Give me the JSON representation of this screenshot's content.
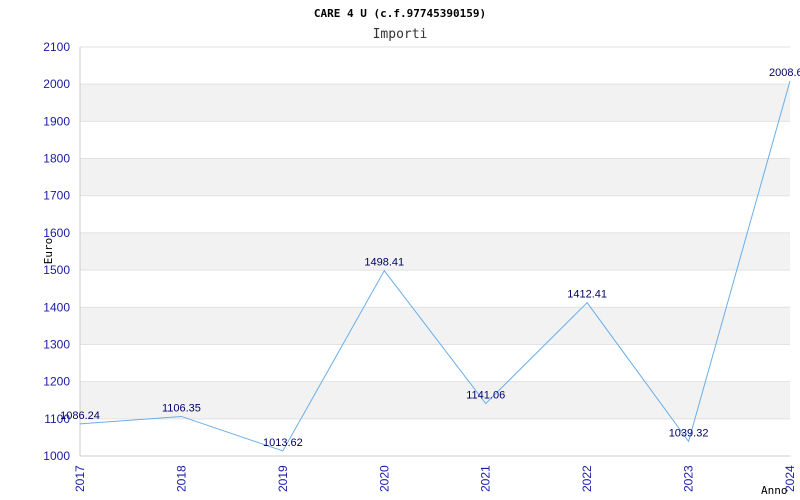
{
  "chart_data": {
    "type": "line",
    "title": "CARE 4 U (c.f.97745390159)",
    "subtitle": "Importi",
    "xlabel": "Anno",
    "ylabel": "Euro",
    "x": [
      "2017",
      "2018",
      "2019",
      "2020",
      "2021",
      "2022",
      "2023",
      "2024"
    ],
    "series": [
      {
        "values": [
          1086.24,
          1106.35,
          1013.62,
          1498.41,
          1141.06,
          1412.41,
          1039.32,
          2008.6
        ],
        "labels": [
          "1086.24",
          "1106.35",
          "1013.62",
          "1498.41",
          "1141.06",
          "1412.41",
          "1039.32",
          "2008.6"
        ],
        "color": "#6aaee8"
      }
    ],
    "ylim": [
      1000,
      2100
    ],
    "yticks": [
      "1000",
      "1100",
      "1200",
      "1300",
      "1400",
      "1500",
      "1600",
      "1700",
      "1800",
      "1900",
      "2000",
      "2100"
    ],
    "grid": true,
    "band_colors": [
      "#ffffff",
      "#f2f2f2"
    ],
    "tick_color": "#1a1aa6"
  }
}
